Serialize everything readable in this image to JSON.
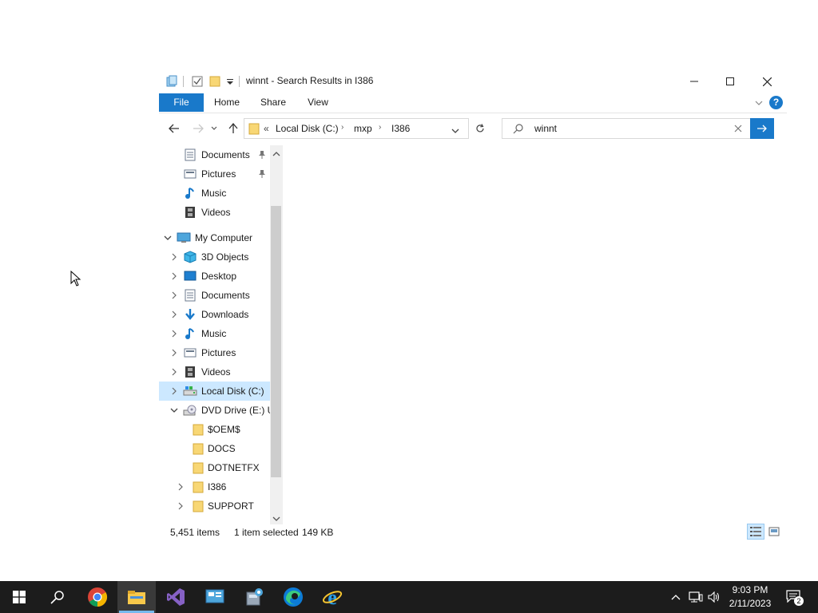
{
  "window": {
    "title": "winnt - Search Results in I386",
    "ribbon_tabs": [
      "File",
      "Home",
      "Share",
      "View"
    ],
    "address": {
      "overflow": "«",
      "crumbs": [
        "Local Disk (C:)",
        "mxp",
        "I386"
      ]
    },
    "search": {
      "value": "winnt"
    },
    "nav_tree": [
      {
        "label": "Documents",
        "icon": "documents-icon",
        "pinned": true
      },
      {
        "label": "Pictures",
        "icon": "pictures-icon",
        "pinned": true
      },
      {
        "label": "Music",
        "icon": "music-icon"
      },
      {
        "label": "Videos",
        "icon": "videos-icon"
      },
      {
        "label": "My Computer",
        "icon": "computer-icon",
        "expanded": true
      },
      {
        "label": "3D Objects",
        "icon": "3d-objects-icon"
      },
      {
        "label": "Desktop",
        "icon": "desktop-icon"
      },
      {
        "label": "Documents",
        "icon": "documents-icon"
      },
      {
        "label": "Downloads",
        "icon": "downloads-icon"
      },
      {
        "label": "Music",
        "icon": "music-icon"
      },
      {
        "label": "Pictures",
        "icon": "pictures-icon"
      },
      {
        "label": "Videos",
        "icon": "videos-icon"
      },
      {
        "label": "Local Disk (C:)",
        "icon": "local-disk-icon",
        "selected": true
      },
      {
        "label": "DVD Drive (E:) UI",
        "icon": "dvd-drive-icon",
        "expanded": true
      },
      {
        "label": "$OEM$",
        "icon": "folder-icon"
      },
      {
        "label": "DOCS",
        "icon": "folder-icon"
      },
      {
        "label": "DOTNETFX",
        "icon": "folder-icon"
      },
      {
        "label": "I386",
        "icon": "folder-icon"
      },
      {
        "label": "SUPPORT",
        "icon": "folder-icon"
      }
    ],
    "status": {
      "items": "5,451 items",
      "selected": "1 item selected",
      "size": "149 KB"
    }
  },
  "taskbar": {
    "apps": [
      "start-icon",
      "search-icon",
      "chrome-icon",
      "file-explorer-icon",
      "visual-studio-icon",
      "control-panel-icon",
      "admin-tools-icon",
      "edge-icon",
      "internet-explorer-icon"
    ],
    "clock": {
      "time": "9:03 PM",
      "date": "2/11/2023"
    },
    "notification_count": "2"
  },
  "colors": {
    "accent": "#1979ca",
    "selection": "#cce8ff",
    "taskbar": "#1c1c1c",
    "folder": "#f8d775"
  }
}
